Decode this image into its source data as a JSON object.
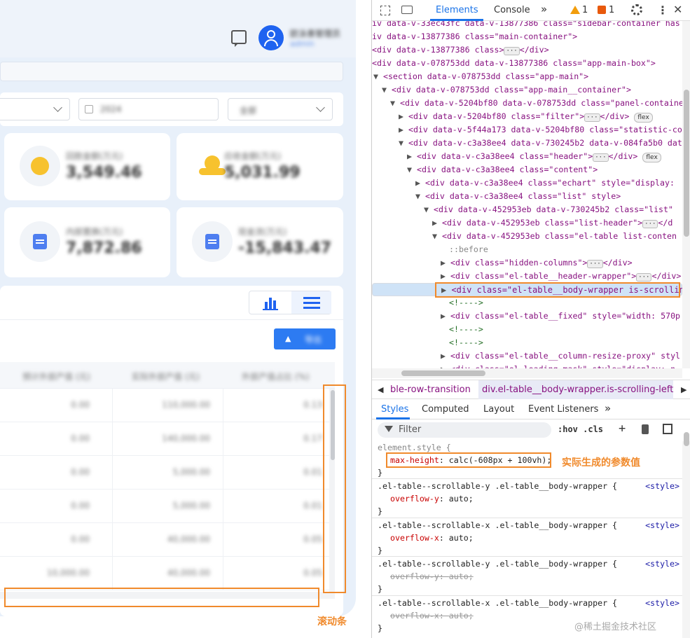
{
  "app": {
    "user": {
      "name": "欧泳善管理员",
      "role": "admin"
    },
    "filter": {
      "select1_value": "",
      "year_value": "2024",
      "select3_value": "全部"
    },
    "cards": [
      {
        "label": "回款金额(万元)",
        "value": "3,549.46"
      },
      {
        "label": "应收金额(万元)",
        "value": "5,031.99"
      },
      {
        "label": "内部置换(万元)",
        "value": "7,872.86"
      },
      {
        "label": "现金流(万元)",
        "value": "-15,843.47"
      }
    ],
    "export_label": "导出",
    "table": {
      "headers": [
        "预计外部产值 (元)",
        "实际外部产值 (元)",
        "外部产值占比 (%)"
      ],
      "rows": [
        [
          "0.00",
          "110,000.00",
          "0.13"
        ],
        [
          "0.00",
          "140,000.00",
          "0.17"
        ],
        [
          "0.00",
          "5,000.00",
          "0.01"
        ],
        [
          "0.00",
          "5,000.00",
          "0.01"
        ],
        [
          "0.00",
          "40,000.00",
          "0.05"
        ],
        [
          "10,000.00",
          "40,000.00",
          "0.05"
        ]
      ]
    },
    "annotations": {
      "scrollbar_label": "滚动条",
      "param_label": "实际生成的参数值"
    }
  },
  "devtools": {
    "tabs": [
      "Elements",
      "Console"
    ],
    "more": "»",
    "warn_count": "1",
    "err_count": "1",
    "tree": [
      {
        "indent": 0,
        "html": "iv data-v-33ec43fc data-v-13877386 class=\"sidebar-container has"
      },
      {
        "indent": 0,
        "html": "iv data-v-13877386 class=\"main-container\">"
      },
      {
        "indent": 0,
        "html": "<div data-v-13877386 class>",
        "ell": true,
        "close": "</div>"
      },
      {
        "indent": 0,
        "html": "<div data-v-078753dd data-v-13877386 class=\"app-main-box\">"
      },
      {
        "indent": 0,
        "arrow": "▼",
        "html": "<section data-v-078753dd class=\"app-main\">"
      },
      {
        "indent": 1,
        "arrow": "▼",
        "html": "<div data-v-078753dd class=\"app-main__container\">"
      },
      {
        "indent": 2,
        "arrow": "▼",
        "html": "<div data-v-5204bf80 data-v-078753dd class=\"panel-containe"
      },
      {
        "indent": 3,
        "arrow": "▶",
        "html": "<div data-v-5204bf80 class=\"filter\">",
        "ell": true,
        "close": "</div>",
        "badge": "flex"
      },
      {
        "indent": 3,
        "arrow": "▶",
        "html": "<div data-v-5f44a173 data-v-5204bf80 class=\"statistic-co"
      },
      {
        "indent": 3,
        "arrow": "▼",
        "html": "<div data-v-c3a38ee4 data-v-730245b2 data-v-084fa5b0 dat"
      },
      {
        "indent": 4,
        "arrow": "▶",
        "html": "<div data-v-c3a38ee4 class=\"header\">",
        "ell": true,
        "close": "</div>",
        "badge": "flex"
      },
      {
        "indent": 4,
        "arrow": "▼",
        "html": "<div data-v-c3a38ee4 class=\"content\">"
      },
      {
        "indent": 5,
        "arrow": "▶",
        "html": "<div data-v-c3a38ee4 class=\"echart\" style=\"display:"
      },
      {
        "indent": 5,
        "arrow": "▼",
        "html": "<div data-v-c3a38ee4 class=\"list\" style>"
      },
      {
        "indent": 6,
        "arrow": "▼",
        "html": "<div data-v-452953eb data-v-730245b2 class=\"list\""
      },
      {
        "indent": 7,
        "arrow": "▶",
        "html": "<div data-v-452953eb class=\"list-header\">",
        "ell": true,
        "close": "</d"
      },
      {
        "indent": 7,
        "arrow": "▼",
        "html": "<div data-v-452953eb class=\"el-table list-conten"
      },
      {
        "indent": 8,
        "html": "::before",
        "pseudo": true
      },
      {
        "indent": 8,
        "arrow": "▶",
        "html": "<div class=\"hidden-columns\">",
        "ell": true,
        "close": "</div>"
      },
      {
        "indent": 8,
        "arrow": "▶",
        "html": "<div class=\"el-table__header-wrapper\">",
        "ell": true,
        "close": "</div>"
      },
      {
        "indent": 8,
        "arrow": "▶",
        "html": "<div class=\"el-table__body-wrapper is-scrollin",
        "selected": true
      },
      {
        "indent": 8,
        "html": "<!---->",
        "comment": true
      },
      {
        "indent": 8,
        "arrow": "▶",
        "html": "<div class=\"el-table__fixed\" style=\"width: 570p"
      },
      {
        "indent": 8,
        "html": "<!---->",
        "comment": true
      },
      {
        "indent": 8,
        "html": "<!---->",
        "comment": true
      },
      {
        "indent": 8,
        "arrow": "▶",
        "html": "<div class=\"el-table__column-resize-proxy\" styl"
      },
      {
        "indent": 8,
        "arrow": "▶",
        "html": "<div class=\"el-loading-mask\" style=\"display: n"
      }
    ],
    "breadcrumb": [
      "ble-row-transition",
      "div.el-table__body-wrapper.is-scrolling-left"
    ],
    "style_tabs": [
      "Styles",
      "Computed",
      "Layout",
      "Event Listeners",
      "»"
    ],
    "filter_placeholder": "Filter",
    "hov": ":hov .cls",
    "rules": [
      {
        "selector": "element.style {",
        "prop": "max-height",
        "value": "calc(-608px + 100vh);"
      },
      {
        "selector": ".el-table--scrollable-y .el-table__body-wrapper {",
        "src": "<style>",
        "prop": "overflow-y",
        "value": "auto;"
      },
      {
        "selector": ".el-table--scrollable-x .el-table__body-wrapper {",
        "src": "<style>",
        "prop": "overflow-x",
        "value": "auto;"
      },
      {
        "selector": ".el-table--scrollable-y .el-table__body-wrapper {",
        "src": "<style>",
        "prop": "overflow-y",
        "value": "auto;",
        "struck": true
      },
      {
        "selector": ".el-table--scrollable-x .el-table__body-wrapper {",
        "src": "<style>",
        "prop": "overflow-x",
        "value": "auto;",
        "struck": true
      }
    ],
    "watermark": "@稀土掘金技术社区"
  }
}
